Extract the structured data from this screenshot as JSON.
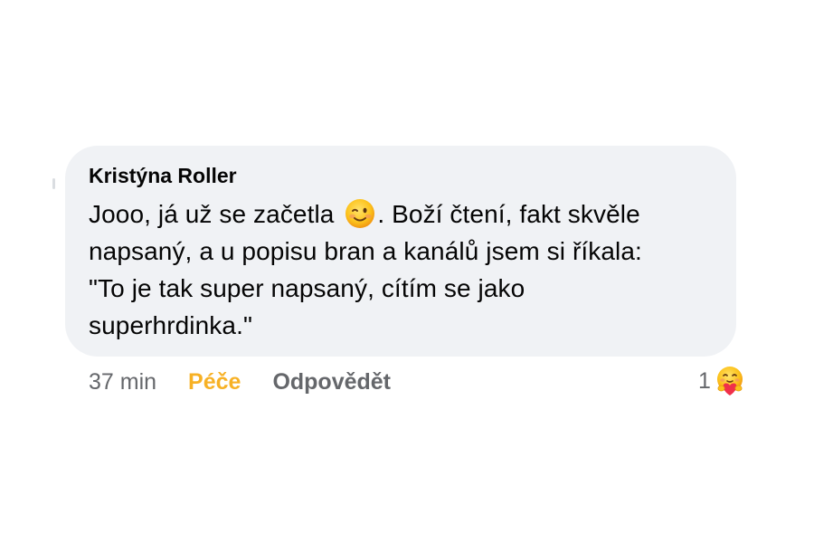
{
  "comment": {
    "author": "Kristýna Roller",
    "line1_before_emoji": "Jooo, já už se začetla",
    "line1_after_emoji": ". Boží čtení, fakt skvěle",
    "line2": "napsaný, a u popisu bran a kanálů jsem si říkala:",
    "line3": "\"To je tak super napsaný, cítím se jako",
    "line4": "superhrdinka.\"",
    "inline_emoji": "winking-face-icon"
  },
  "actions": {
    "time": "37 min",
    "reaction_label": "Péče",
    "reply_label": "Odpovědět"
  },
  "reactions": {
    "count": "1",
    "emoji": "care-hugging-heart-icon"
  },
  "colors": {
    "bubble_bg": "#f0f2f5",
    "text": "#050505",
    "secondary": "#65676b",
    "care_reaction": "#f7b125"
  }
}
